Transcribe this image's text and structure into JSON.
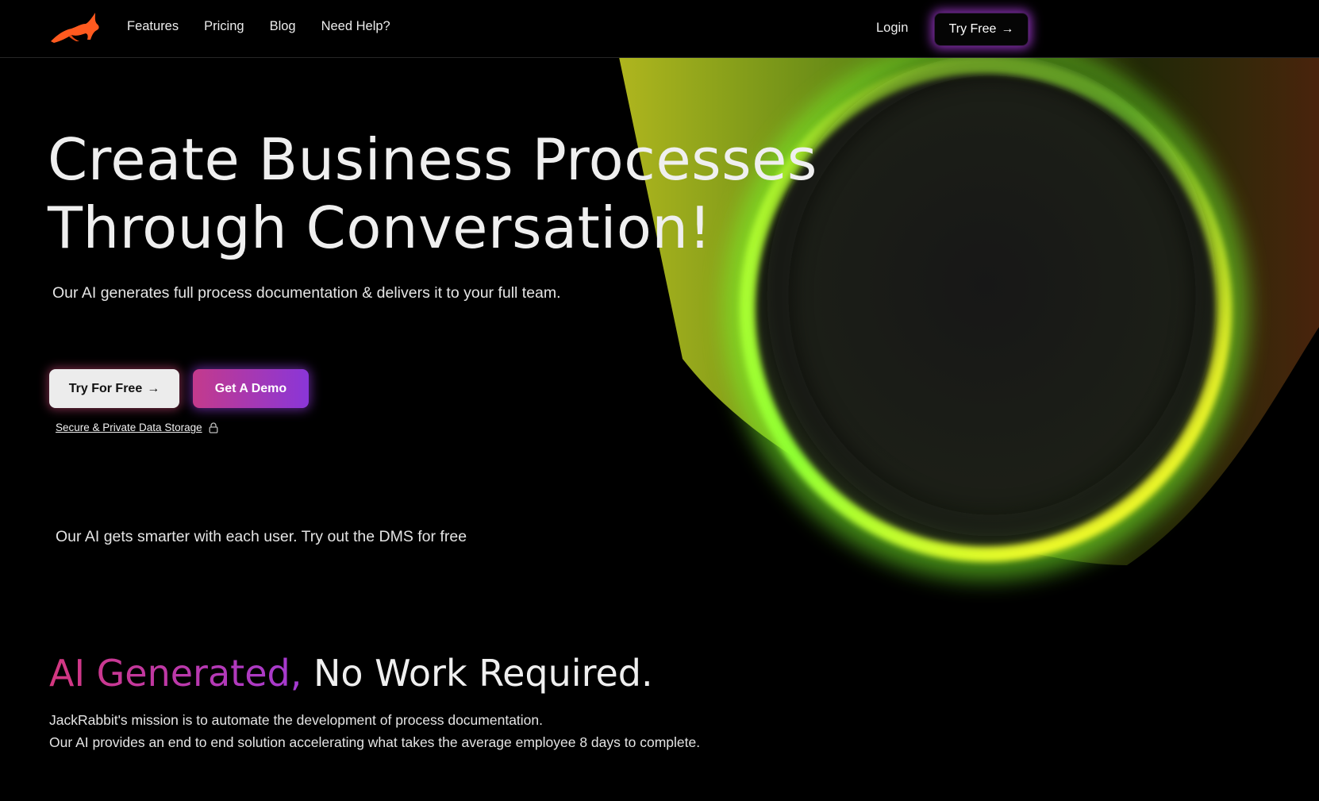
{
  "nav": {
    "links": [
      "Features",
      "Pricing",
      "Blog",
      "Need Help?"
    ],
    "login_label": "Login",
    "try_free_label": "Try Free",
    "try_free_arrow": "→"
  },
  "hero": {
    "title_line1": "Create Business Processes",
    "title_line2": "Through Conversation!",
    "subtitle": "Our AI generates full process documentation & delivers it to your full team.",
    "try_button_label": "Try For Free",
    "try_button_arrow": "→",
    "demo_button_label": "Get A Demo",
    "secure_label": "Secure & Private Data Storage",
    "smarter_text": "Our AI gets smarter with each user. Try out the DMS for free"
  },
  "section": {
    "title_accent": "AI Generated,",
    "title_rest": "No Work Required.",
    "mission_line1": "JackRabbit's mission is to automate the development of process documentation.",
    "mission_line2": "Our AI provides an end to end solution accelerating what takes the average employee 8 days to complete."
  },
  "icons": {
    "logo": "leaping-rabbit-logo",
    "arrow": "arrow-right-icon",
    "lock": "lock-icon"
  },
  "colors": {
    "background": "#000000",
    "logo_orange": "#ff5a1f",
    "ring_green": "#9cff2e",
    "ring_yellow": "#fbff2a",
    "accent_pink": "#d4377f",
    "accent_purple": "#8a36d8",
    "nav_glow": "#c446ff"
  }
}
